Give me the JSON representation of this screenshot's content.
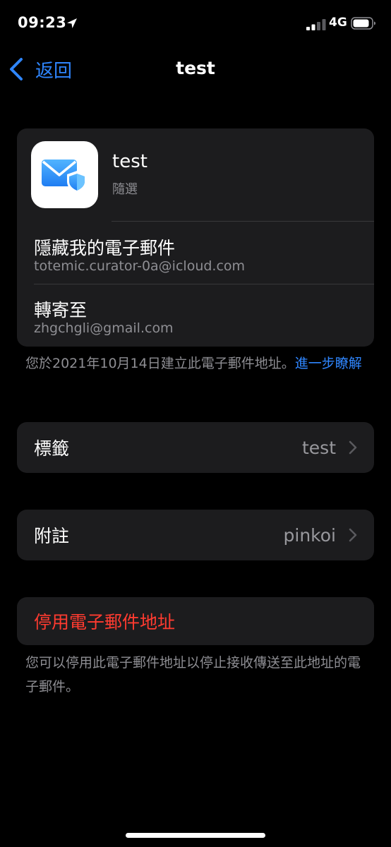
{
  "status": {
    "time": "09:23",
    "network": "4G"
  },
  "nav": {
    "back_label": "返回",
    "title": "test"
  },
  "card": {
    "app_title": "test",
    "app_subtitle": "隨選",
    "hide_email_title": "隱藏我的電子郵件",
    "hide_email_address": "totemic.curator-0a@icloud.com",
    "forward_title": "轉寄至",
    "forward_address": "zhgchgli@gmail.com"
  },
  "created_note": {
    "text": "您於2021年10月14日建立此電子郵件地址。",
    "link": "進一步瞭解"
  },
  "label_row": {
    "label": "標籤",
    "value": "test"
  },
  "note_row": {
    "label": "附註",
    "value": "pinkoi"
  },
  "deactivate": {
    "label": "停用電子郵件地址",
    "footnote": "您可以停用此電子郵件地址以停止接收傳送至此地址的電子郵件。"
  },
  "colors": {
    "accent": "#2f86ff",
    "danger": "#ff3b30",
    "background": "#000000",
    "card": "#1c1c1e",
    "secondary_text": "#8e8e93"
  },
  "icons": [
    "location-arrow-icon",
    "signal-icon",
    "battery-icon",
    "back-chevron-icon",
    "mail-shield-icon",
    "chevron-right-icon"
  ]
}
